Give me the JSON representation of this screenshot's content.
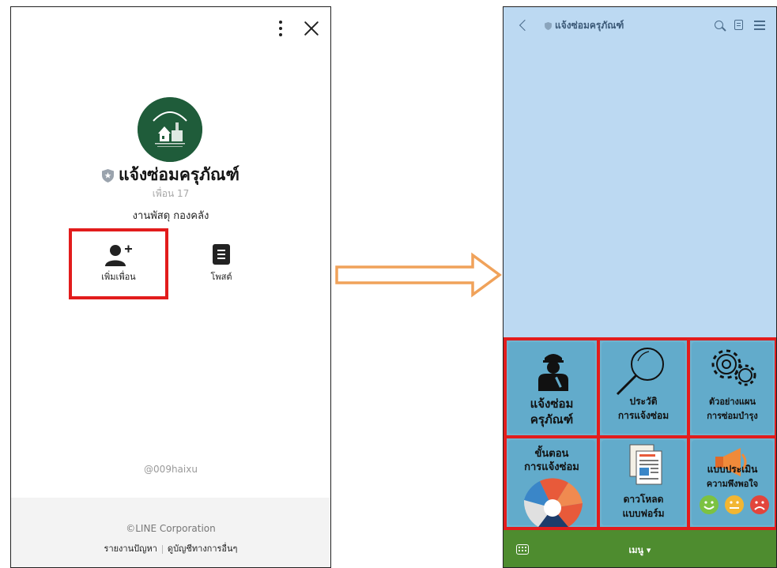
{
  "profile": {
    "name": "แจ้งซ่อมครุภัณฑ์",
    "friends": "เพื่อน 17",
    "subtitle": "งานพัสดุ กองคลัง",
    "add_friend_label": "เพิ่มเพื่อน",
    "post_label": "โพสต์",
    "handle": "@009haixu",
    "copyright": "©LINE Corporation",
    "report_link": "รายงานปัญหา",
    "other_accounts_link": "ดูบัญชีทางการอื่นๆ"
  },
  "chat": {
    "title": "แจ้งซ่อมครุภัณฑ์",
    "menu_label": "เมนู ▾",
    "tiles": [
      {
        "line1": "แจ้งซ่อม",
        "line2": "ครุภัณฑ์"
      },
      {
        "line1": "ประวัติ",
        "line2": "การแจ้งซ่อม"
      },
      {
        "line1": "ตัวอย่างแผน",
        "line2": "การซ่อมบำรุง"
      },
      {
        "line1": "ขั้นตอน",
        "line2": "การแจ้งซ่อม"
      },
      {
        "line1": "ดาวโหลด",
        "line2": "แบบฟอร์ม"
      },
      {
        "line1": "แบบประเมิน",
        "line2": "ความพึงพอใจ"
      }
    ]
  },
  "colors": {
    "highlight": "#e21c1c",
    "chat_bg": "#bcd9f2",
    "tile_bg": "#62abcb",
    "bottom_bar": "#4e8c2f",
    "arrow": "#f0a25a"
  }
}
